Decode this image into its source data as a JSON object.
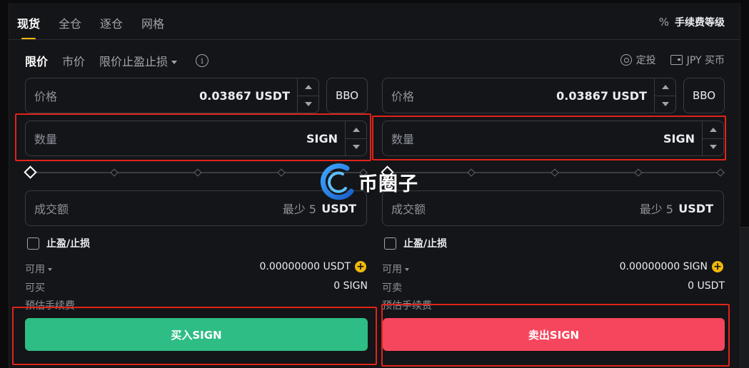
{
  "tabs": [
    {
      "label": "现货",
      "active": true
    },
    {
      "label": "全仓",
      "active": false
    },
    {
      "label": "逐仓",
      "active": false
    },
    {
      "label": "网格",
      "active": false
    }
  ],
  "fee_level": {
    "icon": "percent-icon",
    "label": "手续费等级"
  },
  "order_types": [
    {
      "label": "限价",
      "active": true
    },
    {
      "label": "市价",
      "active": false
    },
    {
      "label": "限价止盈止损",
      "active": false,
      "dropdown": true
    }
  ],
  "top_links": {
    "recurring": "定投",
    "buy_fiat": "JPY 买币"
  },
  "buy": {
    "price_label": "价格",
    "price_value": "0.03867",
    "price_unit": "USDT",
    "bbo": "BBO",
    "qty_label": "数量",
    "qty_unit": "SIGN",
    "total_label": "成交额",
    "total_min": "最少 5",
    "total_unit": "USDT",
    "tpsl": "止盈/止损",
    "available_label": "可用",
    "available_value": "0.00000000 USDT",
    "max_label": "可买",
    "max_value": "0 SIGN",
    "fee_label": "预估手续费",
    "button": "买入SIGN"
  },
  "sell": {
    "price_label": "价格",
    "price_value": "0.03867",
    "price_unit": "USDT",
    "bbo": "BBO",
    "qty_label": "数量",
    "qty_unit": "SIGN",
    "total_label": "成交额",
    "total_min": "最少 5",
    "total_unit": "USDT",
    "tpsl": "止盈/止损",
    "available_label": "可用",
    "available_value": "0.00000000 SIGN",
    "max_label": "可卖",
    "max_value": "0 USDT",
    "fee_label": "预估手续费",
    "button": "卖出SIGN"
  },
  "watermark": "币圈子",
  "colors": {
    "buy": "#2ebd85",
    "sell": "#f6465d",
    "accent": "#f0b90b",
    "highlight": "#e0241a"
  }
}
